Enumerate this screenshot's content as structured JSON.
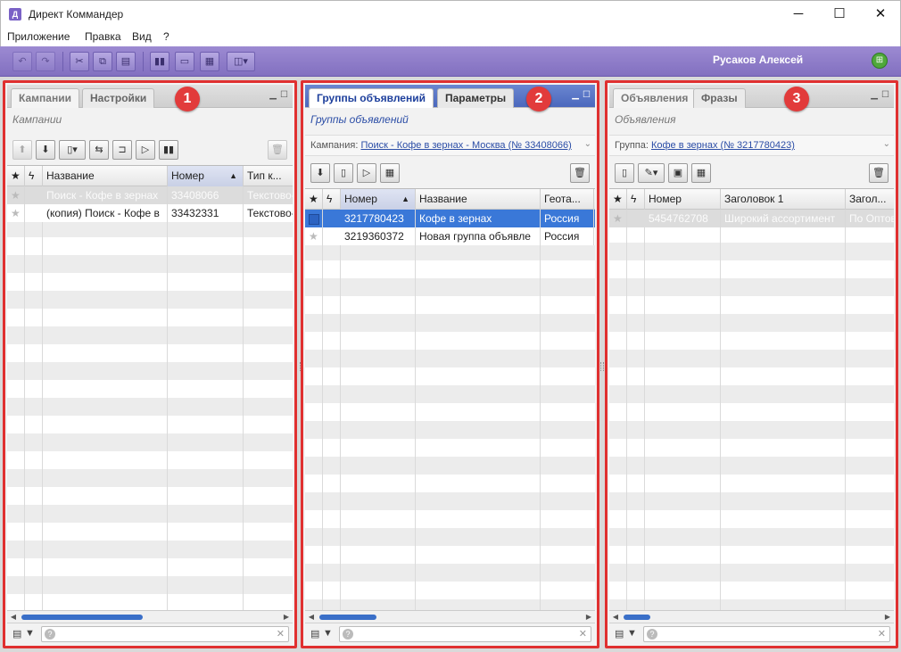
{
  "window": {
    "title": "Директ Коммандер",
    "minimize": "─",
    "maximize": "☐",
    "close": "✕",
    "icon": "Д"
  },
  "menu": [
    "Приложение",
    "Правка",
    "Вид",
    "?"
  ],
  "toolbar": {
    "user": "Русаков Алексей",
    "status_icon": "network-status-icon",
    "icons": [
      "undo-icon",
      "redo-icon",
      "cut-icon",
      "copy-icon",
      "paste-icon",
      "stats-icon",
      "battery-icon",
      "table-icon",
      "view-icon"
    ]
  },
  "colors": {
    "toolbar": "#8f7dc9",
    "accent": "#3a78d8",
    "badge": "#e23b3b"
  },
  "panels": [
    {
      "badge": "1",
      "tabs": [
        "Кампании",
        "Настройки"
      ],
      "subtitle": "Кампании",
      "columns": [
        "Название",
        "Номер",
        "Тип к..."
      ],
      "rows": [
        {
          "name": "Поиск - Кофе в зернах",
          "number": "33408066",
          "extra": "Текстово-"
        },
        {
          "name": "(копия) Поиск - Кофе в",
          "number": "33432331",
          "extra": "Текстово-"
        }
      ]
    },
    {
      "badge": "2",
      "tabs": [
        "Группы объявлений",
        "Параметры"
      ],
      "subtitle": "Группы объявлений",
      "context_label": "Кампания:",
      "context_link": "Поиск - Кофе в зернах - Москва (№ 33408066)",
      "columns": [
        "Номер",
        "Название",
        "Геота..."
      ],
      "rows": [
        {
          "number": "3217780423",
          "name": "Кофе в зернах",
          "extra": "Россия"
        },
        {
          "number": "3219360372",
          "name": "Новая группа объявле",
          "extra": "Россия"
        }
      ]
    },
    {
      "badge": "3",
      "tabs": [
        "Объявления",
        "Фразы"
      ],
      "subtitle": "Объявления",
      "context_label": "Группа:",
      "context_link": "Кофе в зернах (№ 3217780423)",
      "columns": [
        "Номер",
        "Заголовок 1",
        "Загол..."
      ],
      "rows": [
        {
          "number": "5454762708",
          "name": "Широкий ассортимент",
          "extra": "По Оптов"
        }
      ]
    }
  ]
}
